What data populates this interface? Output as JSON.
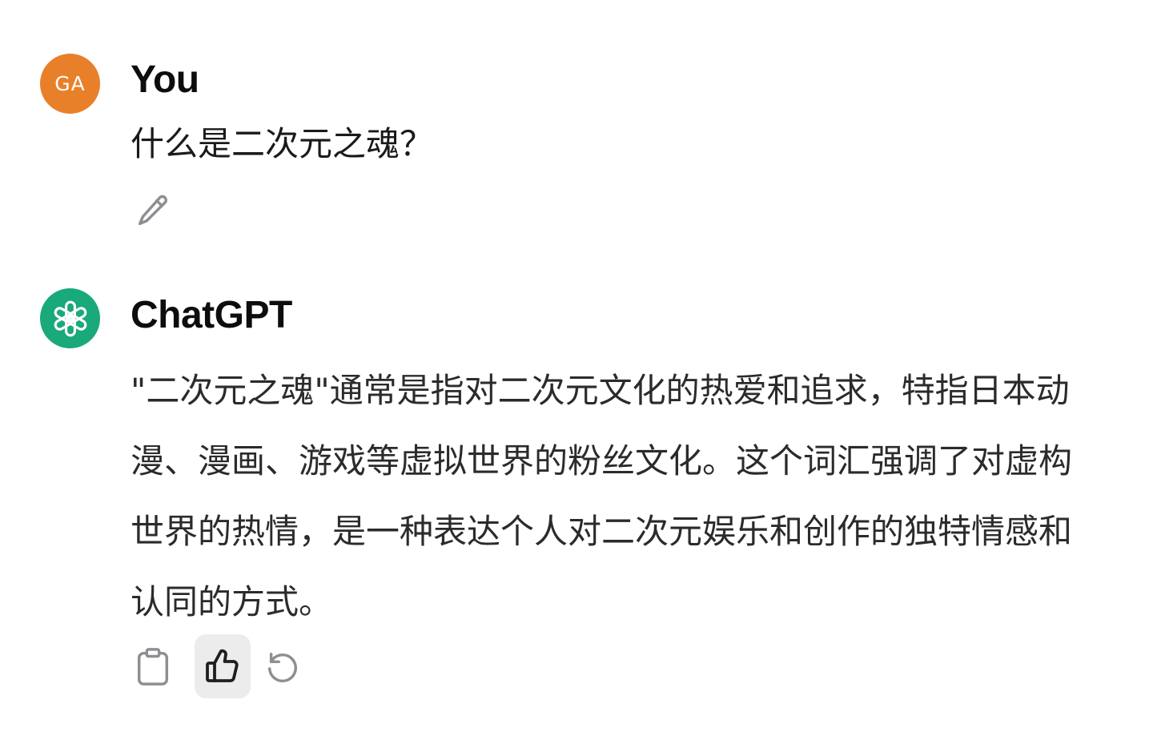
{
  "conversation": {
    "user": {
      "avatar_initials": "GA",
      "avatar_color": "#e8802a",
      "name": "You",
      "message": "什么是二次元之魂？",
      "actions": {
        "edit_icon": "pencil-icon"
      }
    },
    "assistant": {
      "avatar_icon": "openai-logo-icon",
      "avatar_color": "#19a97b",
      "name": "ChatGPT",
      "message": "\"二次元之魂\"通常是指对二次元文化的热爱和追求，特指日本动漫、漫画、游戏等虚拟世界的粉丝文化。这个词汇强调了对虚构世界的热情，是一种表达个人对二次元娱乐和创作的独特情感和认同的方式。",
      "actions": {
        "copy_icon": "clipboard-icon",
        "like_icon": "thumbs-up-icon",
        "regenerate_icon": "regenerate-icon"
      }
    }
  }
}
